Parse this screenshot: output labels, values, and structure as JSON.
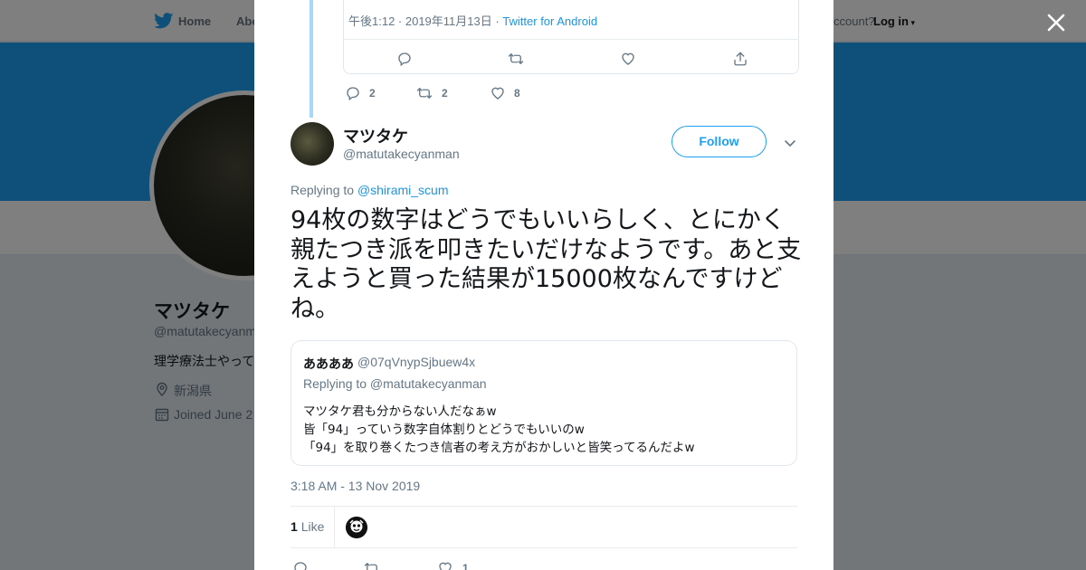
{
  "topbar": {
    "home_label": "Home",
    "about_label": "Abo",
    "account_prompt": "ccount?",
    "login_label": "Log in"
  },
  "profile": {
    "name": "マツタケ",
    "handle": "@matutakecyanm",
    "bio": "理学療法士やって",
    "location": "新潟県",
    "joined": "Joined June 2"
  },
  "modal": {
    "inner_tweet": {
      "meta_time": "午後1:12 · 2019年11月13日 ·",
      "meta_source": "Twitter for Android"
    },
    "parent_stats": {
      "replies": "2",
      "retweets": "2",
      "likes": "8"
    },
    "tweet": {
      "name": "マツタケ",
      "handle": "@matutakecyanman",
      "follow_label": "Follow",
      "replying_prefix": "Replying to",
      "replying_to": "@shirami_scum",
      "text": "94枚の数字はどうでもいいらしく、とにかく親たつき派を叩きたいだけなようです。あと支えようと買った結果が15000枚なんですけどね。",
      "timestamp": "3:18 AM - 13 Nov 2019",
      "likes_number": "1",
      "likes_label": "Like",
      "bottom_likes": "1"
    },
    "quote": {
      "name": "ああああ",
      "handle": "@07qVnypSjbuew4x",
      "replying": "Replying to @matutakecyanman",
      "lines": [
        "マツタケ君も分からない人だなぁw",
        "皆「94」っていう数字自体割りとどうでもいいのw",
        "「94」を取り巻くたつき信者の考え方がおかしいと皆笑ってるんだよw"
      ]
    }
  },
  "colors": {
    "accent": "#1da1f2",
    "link": "#1b95e0",
    "thread_line": "#a4d9f9",
    "muted": "#657786"
  },
  "icons": [
    "twitter-bird-icon",
    "close-icon",
    "reply-icon",
    "retweet-icon",
    "heart-icon",
    "share-icon",
    "chevron-down-icon",
    "location-icon",
    "calendar-icon"
  ]
}
